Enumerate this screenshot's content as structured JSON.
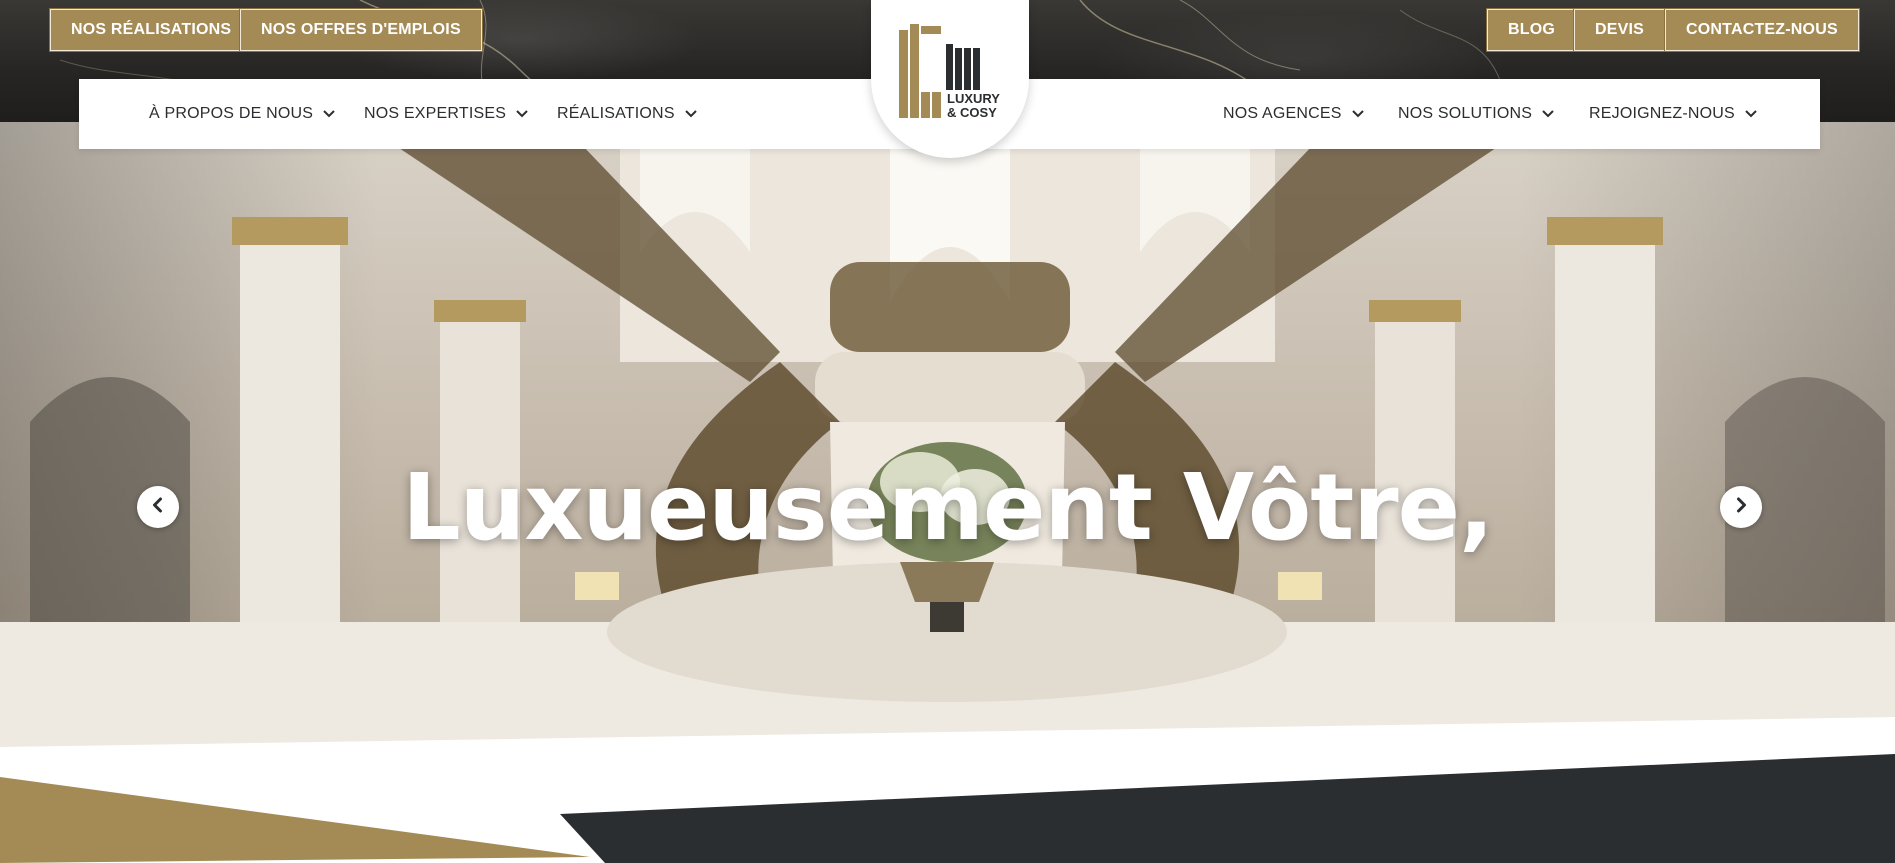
{
  "top_buttons": {
    "realisations": "NOS RÉALISATIONS",
    "offres": "NOS OFFRES D'EMPLOIS",
    "blog": "BLOG",
    "devis": "DEVIS",
    "contact": "CONTACTEZ-NOUS"
  },
  "nav": {
    "left": [
      {
        "label": "À PROPOS DE NOUS"
      },
      {
        "label": "NOS EXPERTISES"
      },
      {
        "label": "RÉALISATIONS"
      }
    ],
    "right": [
      {
        "label": "NOS AGENCES"
      },
      {
        "label": "NOS SOLUTIONS"
      },
      {
        "label": "REJOIGNEZ-NOUS"
      }
    ]
  },
  "logo": {
    "line1": "LUXURY",
    "line2": "& COSY"
  },
  "hero": {
    "title": "Luxueusement Vôtre,"
  },
  "colors": {
    "gold": "#a48a54",
    "dark": "#2b2e30",
    "white": "#ffffff"
  },
  "icons": {
    "dropdown": "chevron-down-icon",
    "prev": "chevron-left-icon",
    "next": "chevron-right-icon"
  }
}
